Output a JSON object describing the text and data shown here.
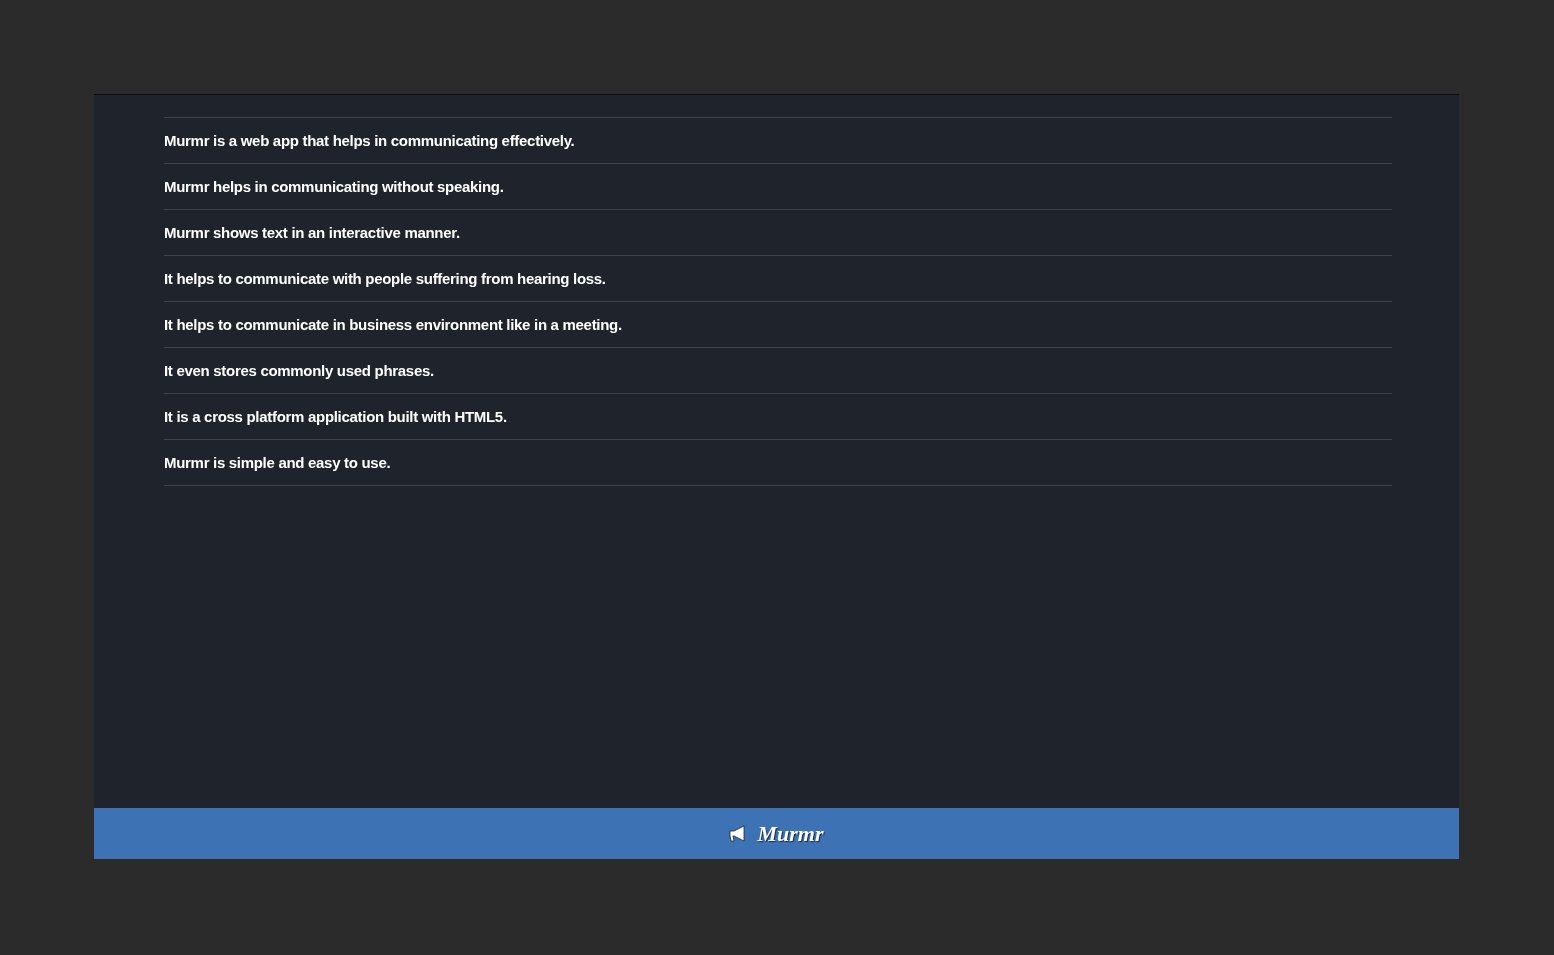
{
  "features": [
    "Murmr is a web app that helps in communicating effectively.",
    "Murmr helps in communicating without speaking.",
    "Murmr shows text in an interactive manner.",
    "It helps to communicate with people suffering from hearing loss.",
    "It helps to communicate in business environment like in a meeting.",
    "It even stores commonly used phrases.",
    "It is a cross platform application built with HTML5.",
    "Murmr is simple and easy to use."
  ],
  "footer": {
    "brand": "Murmr"
  }
}
